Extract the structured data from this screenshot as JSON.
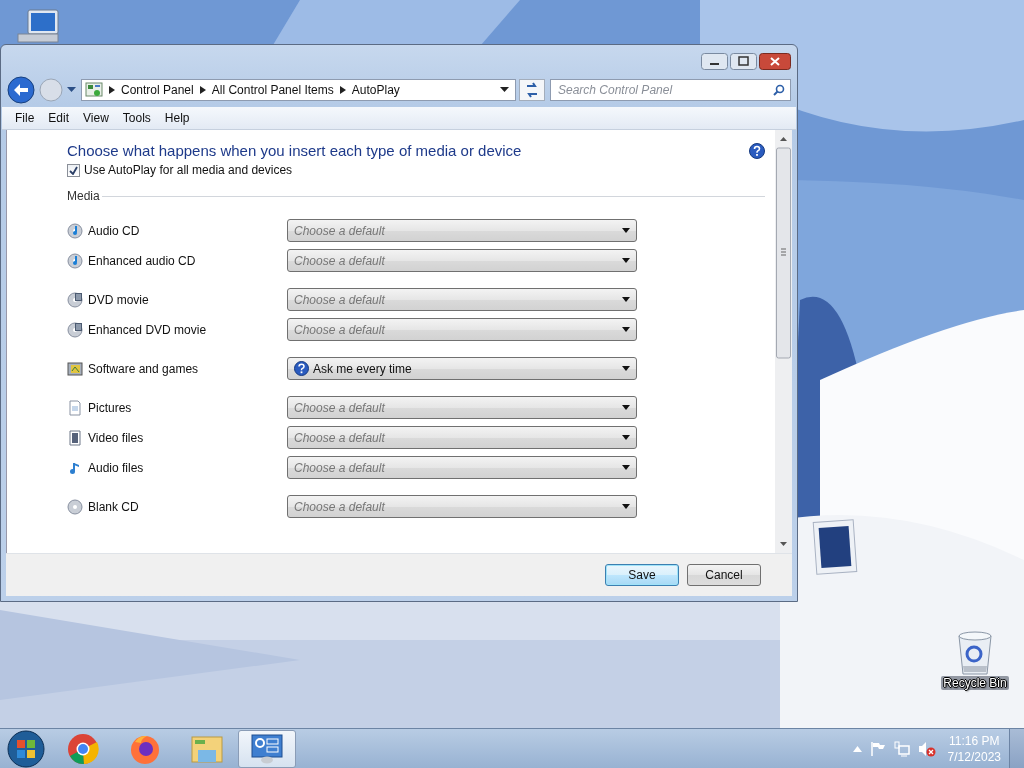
{
  "window": {
    "nav": {
      "breadcrumb": [
        "Control Panel",
        "All Control Panel Items",
        "AutoPlay"
      ],
      "search_placeholder": "Search Control Panel"
    },
    "menu": [
      "File",
      "Edit",
      "View",
      "Tools",
      "Help"
    ],
    "heading": "Choose what happens when you insert each type of media or device",
    "autoplay_checkbox": {
      "label": "Use AutoPlay for all media and devices",
      "checked": true
    },
    "section": "Media",
    "groups": [
      {
        "rows": [
          {
            "kind": "audio-cd",
            "label": "Audio CD",
            "choice": "Choose a default",
            "chosen": false
          },
          {
            "kind": "audio-cd",
            "label": "Enhanced audio CD",
            "choice": "Choose a default",
            "chosen": false
          }
        ]
      },
      {
        "rows": [
          {
            "kind": "dvd",
            "label": "DVD movie",
            "choice": "Choose a default",
            "chosen": false
          },
          {
            "kind": "dvd",
            "label": "Enhanced DVD movie",
            "choice": "Choose a default",
            "chosen": false
          }
        ]
      },
      {
        "rows": [
          {
            "kind": "software",
            "label": "Software and games",
            "choice": "Ask me every time",
            "chosen": true
          }
        ]
      },
      {
        "rows": [
          {
            "kind": "pictures",
            "label": "Pictures",
            "choice": "Choose a default",
            "chosen": false
          },
          {
            "kind": "video",
            "label": "Video files",
            "choice": "Choose a default",
            "chosen": false
          },
          {
            "kind": "audio",
            "label": "Audio files",
            "choice": "Choose a default",
            "chosen": false
          }
        ]
      },
      {
        "rows": [
          {
            "kind": "blank-cd",
            "label": "Blank CD",
            "choice": "Choose a default",
            "chosen": false
          }
        ]
      }
    ],
    "buttons": [
      {
        "label": "Save",
        "default": true
      },
      {
        "label": "Cancel",
        "default": false
      }
    ]
  },
  "desktop": {
    "recycle_bin": "Recycle Bin"
  },
  "taskbar": {
    "apps": [
      {
        "kind": "chrome",
        "active": false
      },
      {
        "kind": "firefox",
        "active": false
      },
      {
        "kind": "explorer",
        "active": false
      },
      {
        "kind": "control-panel",
        "active": true
      }
    ],
    "time": "11:16 PM",
    "date": "7/12/2023"
  }
}
